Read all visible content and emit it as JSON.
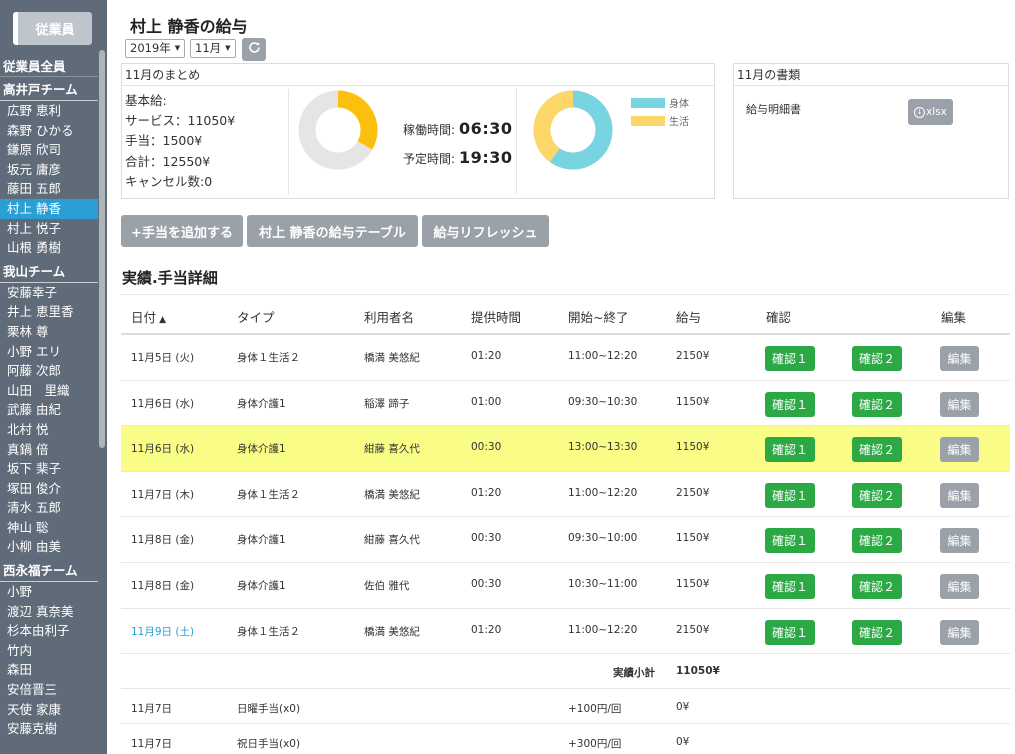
{
  "sidebar": {
    "employee_button": "従業員",
    "all_label": "従業員全員",
    "teams": [
      {
        "name": "高井戸チーム",
        "members": [
          "広野 恵利",
          "森野 ひかる",
          "鎌原 欣司",
          "坂元 庸彦",
          "藤田 五郎",
          "村上 静香",
          "村上 悦子",
          "山根 勇樹"
        ]
      },
      {
        "name": "我山チーム",
        "members": [
          "安藤幸子",
          "井上 恵里香",
          "栗林 尊",
          "小野 エリ",
          "阿藤 次郎",
          "山田　里織",
          "武藤 由紀",
          "北村 悦",
          "真鍋 倍",
          "坂下 棐子",
          "塚田 俊介",
          "清水 五郎",
          "神山 聡",
          "小柳 由美"
        ]
      },
      {
        "name": "西永福チーム",
        "members": [
          "小野",
          "渡辺 真奈美",
          "杉本由利子",
          "竹内",
          "森田",
          "安倍晋三",
          "天使 家康",
          "安藤克樹"
        ]
      }
    ],
    "active_member": "村上 静香"
  },
  "header": {
    "title": "村上 静香の給与",
    "year_select": "2019年",
    "month_select": "11月",
    "refresh_icon": "refresh-icon"
  },
  "summary": {
    "title": "11月のまとめ",
    "lines": [
      "基本給:",
      "サービス：11050¥",
      "手当：1500¥",
      "合計：12550¥",
      "キャンセル数:0"
    ],
    "work_time_label": "稼働時間:",
    "work_time": "06:30",
    "plan_time_label": "予定時間:",
    "plan_time": "19:30",
    "legend": [
      {
        "label": "身体",
        "color": "#77d4e0"
      },
      {
        "label": "生活",
        "color": "#fdd66a"
      }
    ]
  },
  "documents": {
    "title": "11月の書類",
    "item_label": "給与明細書",
    "xlsx_label": "xlsx"
  },
  "actions": {
    "add_allowance": "+手当を追加する",
    "salary_table": "村上 静香の給与テーブル",
    "refresh_salary": "給与リフレッシュ"
  },
  "details": {
    "title": "実績.手当詳細",
    "columns": {
      "date": "日付",
      "type": "タイプ",
      "client": "利用者名",
      "duration": "提供時間",
      "range": "開始~終了",
      "pay": "給与",
      "confirm": "確認",
      "edit": "編集"
    },
    "confirm1_label": "確認１",
    "confirm2_label": "確認２",
    "edit_label": "編集",
    "rows": [
      {
        "date": "11月5日 (火)",
        "type": "身体１生活２",
        "client": "橋満 美悠紀",
        "duration": "01:20",
        "range": "11:00~12:20",
        "pay": "2150¥"
      },
      {
        "date": "11月6日 (水)",
        "type": "身体介護1",
        "client": "稲澤 蹄子",
        "duration": "01:00",
        "range": "09:30~10:30",
        "pay": "1150¥"
      },
      {
        "date": "11月6日 (水)",
        "type": "身体介護1",
        "client": "紺藤 喜久代",
        "duration": "00:30",
        "range": "13:00~13:30",
        "pay": "1150¥"
      },
      {
        "date": "11月7日 (木)",
        "type": "身体１生活２",
        "client": "橋満 美悠紀",
        "duration": "01:20",
        "range": "11:00~12:20",
        "pay": "2150¥"
      },
      {
        "date": "11月8日 (金)",
        "type": "身体介護1",
        "client": "紺藤 喜久代",
        "duration": "00:30",
        "range": "09:30~10:00",
        "pay": "1150¥"
      },
      {
        "date": "11月8日 (金)",
        "type": "身体介護1",
        "client": "佐伯 雅代",
        "duration": "00:30",
        "range": "10:30~11:00",
        "pay": "1150¥"
      },
      {
        "date": "11月9日 (土)",
        "type": "身体１生活２",
        "client": "橋満 美悠紀",
        "duration": "01:20",
        "range": "11:00~12:20",
        "pay": "2150¥"
      }
    ],
    "subtotal_label": "実績小計",
    "subtotal_value": "11050¥",
    "allowances": [
      {
        "date": "11月7日",
        "type": "日曜手当(x0)",
        "rate": "+100円/回",
        "pay": "0¥"
      },
      {
        "date": "11月7日",
        "type": "祝日手当(x0)",
        "rate": "+300円/回",
        "pay": "0¥"
      }
    ]
  },
  "donut_work": {
    "worked_fraction": 0.333,
    "worked_color": "#fbbf0d",
    "rest_color": "#e5e5e5"
  },
  "donut_type": {
    "body_fraction": 0.6,
    "life_fraction": 0.4
  }
}
